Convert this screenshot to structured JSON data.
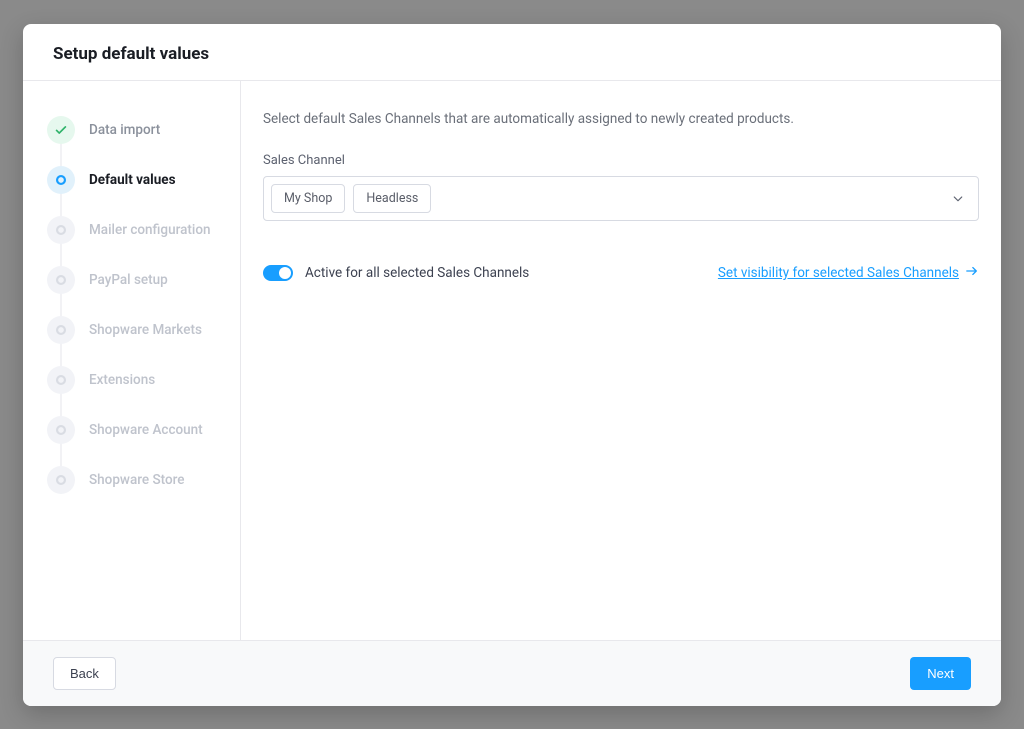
{
  "header": {
    "title": "Setup default values"
  },
  "sidebar": {
    "steps": [
      {
        "label": "Data import",
        "state": "completed"
      },
      {
        "label": "Default values",
        "state": "active"
      },
      {
        "label": "Mailer configuration",
        "state": "pending"
      },
      {
        "label": "PayPal setup",
        "state": "pending"
      },
      {
        "label": "Shopware Markets",
        "state": "pending"
      },
      {
        "label": "Extensions",
        "state": "pending"
      },
      {
        "label": "Shopware Account",
        "state": "pending"
      },
      {
        "label": "Shopware Store",
        "state": "pending"
      }
    ]
  },
  "main": {
    "helptext": "Select default Sales Channels that are automatically assigned to newly created products.",
    "salesChannel": {
      "label": "Sales Channel",
      "selected": [
        "My Shop",
        "Headless"
      ]
    },
    "toggle": {
      "label": "Active for all selected Sales Channels",
      "active": true
    },
    "visibilityLink": "Set visibility for selected Sales Channels"
  },
  "footer": {
    "back": "Back",
    "next": "Next"
  }
}
